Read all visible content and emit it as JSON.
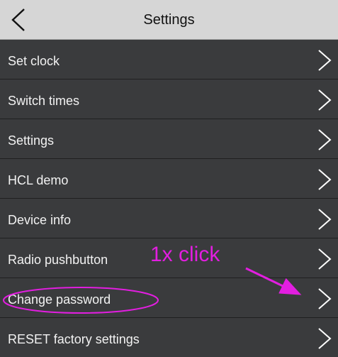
{
  "header": {
    "title": "Settings",
    "back_icon": "chevron-left-icon"
  },
  "menu": {
    "items": [
      {
        "label": "Set clock"
      },
      {
        "label": "Switch times"
      },
      {
        "label": "Settings"
      },
      {
        "label": "HCL demo"
      },
      {
        "label": "Device info"
      },
      {
        "label": "Radio pushbutton"
      },
      {
        "label": "Change password"
      },
      {
        "label": "RESET factory settings"
      }
    ],
    "item_icon": "chevron-right-icon"
  },
  "annotation": {
    "text": "1x click",
    "color": "#e21ee0",
    "highlighted_item": "Change password"
  },
  "colors": {
    "header_bg": "#d6d6d6",
    "list_bg": "#3a3b3d",
    "text": "#f2f2f2"
  }
}
